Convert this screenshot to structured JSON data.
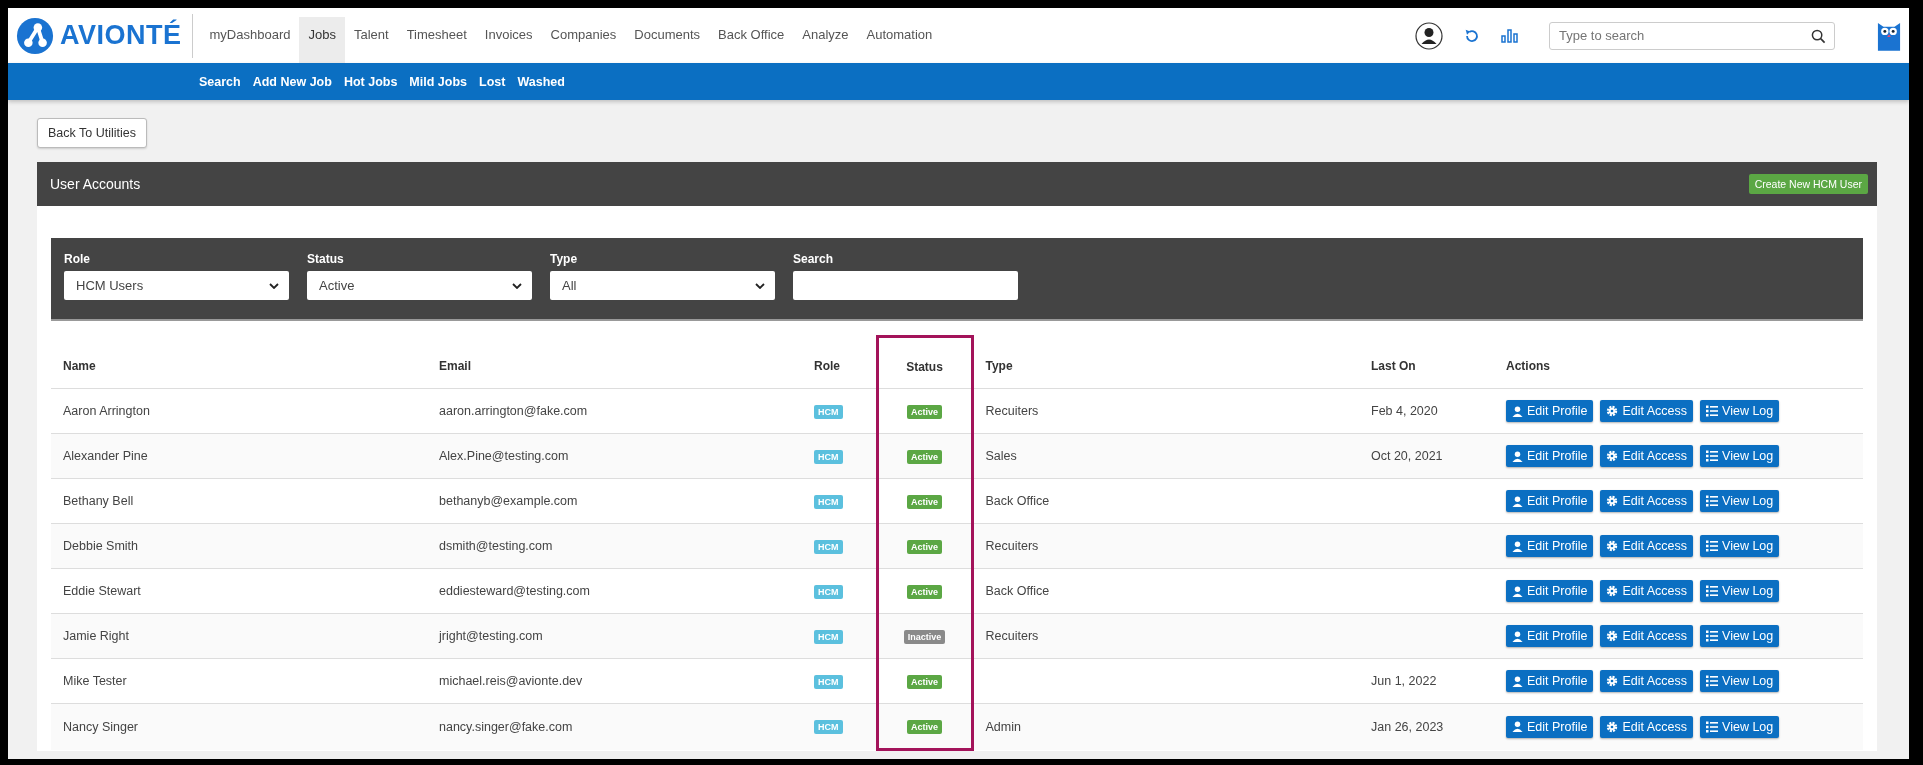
{
  "brand": {
    "name": "AVIONTÉ"
  },
  "nav": [
    {
      "label": "myDashboard",
      "selected": false
    },
    {
      "label": "Jobs",
      "selected": true
    },
    {
      "label": "Talent",
      "selected": false
    },
    {
      "label": "Timesheet",
      "selected": false
    },
    {
      "label": "Invoices",
      "selected": false
    },
    {
      "label": "Companies",
      "selected": false
    },
    {
      "label": "Documents",
      "selected": false
    },
    {
      "label": "Back Office",
      "selected": false
    },
    {
      "label": "Analyze",
      "selected": false
    },
    {
      "label": "Automation",
      "selected": false
    }
  ],
  "global_search": {
    "placeholder": "Type to search"
  },
  "subnav": [
    "Search",
    "Add New Job",
    "Hot Jobs",
    "Mild Jobs",
    "Lost",
    "Washed"
  ],
  "back_button": "Back To Utilities",
  "panel": {
    "title": "User Accounts",
    "create_button": "Create New HCM User"
  },
  "filters": [
    {
      "kind": "select",
      "label": "Role",
      "value": "HCM Users"
    },
    {
      "kind": "select",
      "label": "Status",
      "value": "Active"
    },
    {
      "kind": "select",
      "label": "Type",
      "value": "All"
    },
    {
      "kind": "text",
      "label": "Search"
    }
  ],
  "table": {
    "columns": [
      {
        "label": "Name",
        "highlighted": false
      },
      {
        "label": "Email",
        "highlighted": false
      },
      {
        "label": "Role",
        "highlighted": false
      },
      {
        "label": "Status",
        "highlighted": true
      },
      {
        "label": "Type",
        "highlighted": false
      },
      {
        "label": "Last On",
        "highlighted": false
      },
      {
        "label": "Actions",
        "highlighted": false
      }
    ],
    "rows": [
      {
        "name": "Aaron Arrington",
        "email": "aaron.arrington@fake.com",
        "role": "HCM",
        "status": "Active",
        "active": true,
        "type": "Recuiters",
        "last_on": "Feb 4, 2020",
        "actions": [
          "Edit Profile",
          "Edit Access",
          "View Log"
        ]
      },
      {
        "name": "Alexander Pine",
        "email": "Alex.Pine@testing.com",
        "role": "HCM",
        "status": "Active",
        "active": true,
        "type": "Sales",
        "last_on": "Oct 20, 2021",
        "actions": [
          "Edit Profile",
          "Edit Access",
          "View Log"
        ]
      },
      {
        "name": "Bethany Bell",
        "email": "bethanyb@example.com",
        "role": "HCM",
        "status": "Active",
        "active": true,
        "type": "Back Office",
        "last_on": "",
        "actions": [
          "Edit Profile",
          "Edit Access",
          "View Log"
        ]
      },
      {
        "name": "Debbie Smith",
        "email": "dsmith@testing.com",
        "role": "HCM",
        "status": "Active",
        "active": true,
        "type": "Recuiters",
        "last_on": "",
        "actions": [
          "Edit Profile",
          "Edit Access",
          "View Log"
        ]
      },
      {
        "name": "Eddie Stewart",
        "email": "eddiesteward@testing.com",
        "role": "HCM",
        "status": "Active",
        "active": true,
        "type": "Back Office",
        "last_on": "",
        "actions": [
          "Edit Profile",
          "Edit Access",
          "View Log"
        ]
      },
      {
        "name": "Jamie Right",
        "email": "jright@testing.com",
        "role": "HCM",
        "status": "Inactive",
        "active": false,
        "type": "Recuiters",
        "last_on": "",
        "actions": [
          "Edit Profile",
          "Edit Access",
          "View Log"
        ]
      },
      {
        "name": "Mike Tester",
        "email": "michael.reis@avionte.dev",
        "role": "HCM",
        "status": "Active",
        "active": true,
        "type": "",
        "last_on": "Jun 1, 2022",
        "actions": [
          "Edit Profile",
          "Edit Access",
          "View Log"
        ]
      },
      {
        "name": "Nancy Singer",
        "email": "nancy.singer@fake.com",
        "role": "HCM",
        "status": "Active",
        "active": true,
        "type": "Admin",
        "last_on": "Jan 26, 2023",
        "actions": [
          "Edit Profile",
          "Edit Access",
          "View Log"
        ]
      }
    ]
  }
}
